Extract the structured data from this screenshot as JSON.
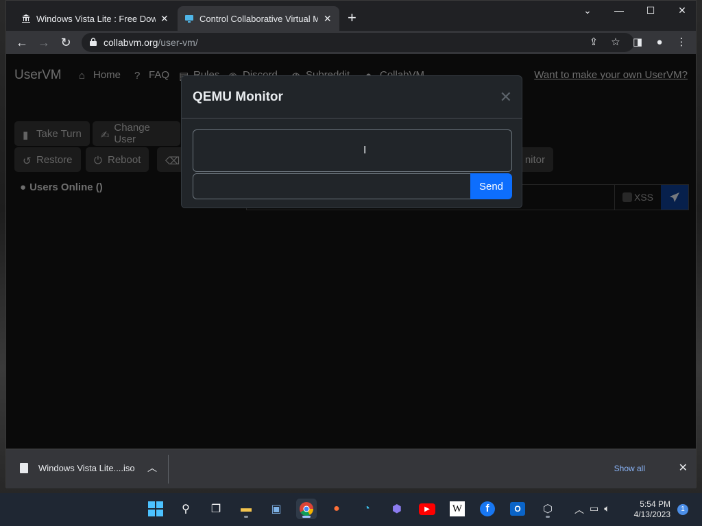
{
  "browser": {
    "tabs": [
      {
        "title": "Windows Vista Lite : Free Downlo",
        "close": "✕"
      },
      {
        "title": "Control Collaborative Virtual Mac",
        "close": "✕"
      }
    ],
    "new_tab": "+",
    "url_host": "collabvm.org",
    "url_path": "/user-vm/"
  },
  "site": {
    "brand": "UserVM",
    "nav": [
      "Home",
      "FAQ",
      "Rules",
      "Discord",
      "Subreddit",
      "CollabVM"
    ],
    "cta": "Want to make your own UserVM?",
    "buttons_row1": [
      "Take Turn",
      "Change User"
    ],
    "buttons_row2": [
      "Restore",
      "Reboot",
      "",
      "nitor"
    ],
    "users_online": "Users Online ()",
    "xss_label": "XSS"
  },
  "modal": {
    "title": "QEMU Monitor",
    "close": "✕",
    "output_value": "",
    "input_value": "",
    "send_label": "Send"
  },
  "downloads": {
    "file": "Windows Vista Lite....iso",
    "show_all": "Show all"
  },
  "taskbar": {
    "time": "5:54 PM",
    "date": "4/13/2023",
    "notifications": "1"
  },
  "colors": {
    "accent": "#0d6efd",
    "modal_bg": "#212529"
  }
}
